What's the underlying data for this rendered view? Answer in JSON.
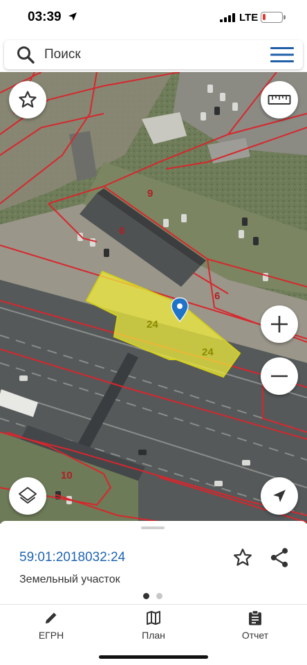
{
  "status_bar": {
    "time": "03:39",
    "network": "LTE",
    "battery_level": 0.15,
    "battery_color": "#e53935"
  },
  "search": {
    "placeholder": "Поиск",
    "icon": "search-icon",
    "menu_icon": "hamburger-menu-icon"
  },
  "map": {
    "parcel_labels": [
      "9",
      "6",
      "6",
      "24",
      "24",
      "10"
    ],
    "selected_parcel_color": "#f2ee3a",
    "boundary_color": "#d8262c",
    "marker_color": "#1f74c8",
    "controls": {
      "favorites_icon": "star-outline-icon",
      "measure_icon": "ruler-icon",
      "zoom_in_icon": "plus-icon",
      "zoom_out_icon": "minus-icon",
      "layers_icon": "layers-icon",
      "location_icon": "navigation-arrow-icon"
    }
  },
  "parcel": {
    "cadastral_number": "59:01:2018032:24",
    "type": "Земельный участок",
    "accent_color": "#1e64b4"
  },
  "pager": {
    "pages": 2,
    "active": 0
  },
  "tabs": [
    {
      "label": "ЕГРН",
      "icon": "pencil-icon"
    },
    {
      "label": "План",
      "icon": "map-icon"
    },
    {
      "label": "Отчет",
      "icon": "clipboard-icon"
    }
  ]
}
